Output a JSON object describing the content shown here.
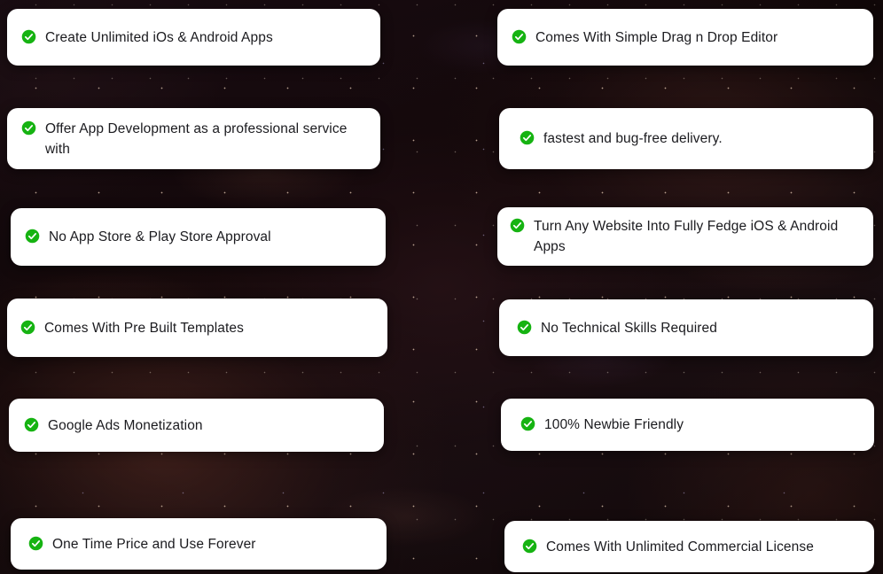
{
  "page": {
    "background_color": "#150a11",
    "accent_color": "#16b312",
    "card_color": "#ffffff",
    "text_color": "#1b1b1f",
    "icon_name": "check-circle-icon"
  },
  "features": {
    "left_column": [
      {
        "label": "Create Unlimited iOs & Android Apps"
      },
      {
        "label": "Offer App Development as a professional service with"
      },
      {
        "label": "No App Store & Play Store Approval"
      },
      {
        "label": "Comes With Pre Built Templates"
      },
      {
        "label": "Google Ads Monetization"
      },
      {
        "label": "One Time Price and Use Forever"
      }
    ],
    "right_column": [
      {
        "label": "Comes With Simple Drag n Drop Editor"
      },
      {
        "label": "fastest and bug-free delivery."
      },
      {
        "label": "Turn Any Website Into Fully Fedge iOS & Android Apps"
      },
      {
        "label": "No Technical Skills Required"
      },
      {
        "label": "100% Newbie Friendly"
      },
      {
        "label": "Comes With Unlimited Commercial License"
      }
    ]
  }
}
